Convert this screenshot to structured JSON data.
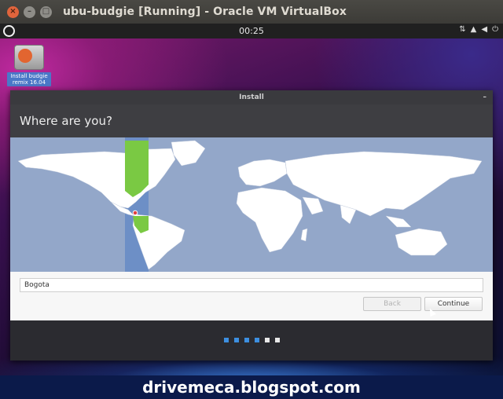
{
  "host_window": {
    "title": "ubu-budgie [Running] - Oracle VM VirtualBox",
    "buttons": {
      "close": "×",
      "minimize": "–",
      "maximize": "□"
    }
  },
  "guest_panel": {
    "clock": "00:25",
    "tray_icons": [
      "network-icon",
      "notification-icon",
      "volume-icon",
      "power-menu-icon"
    ]
  },
  "desktop": {
    "icon_label": "Install budgie remix 16.04"
  },
  "installer": {
    "window_title": "Install",
    "heading": "Where are you?",
    "location_value": "Bogota",
    "back_label": "Back",
    "continue_label": "Continue",
    "progress": {
      "total_steps": 6,
      "completed_steps": 4
    },
    "colors": {
      "accent": "#3d8fe0",
      "timezone_highlight": "#7ac943",
      "ocean": "#93a7c9"
    }
  },
  "watermark": {
    "text": "drivemeca.blogspot.com"
  }
}
